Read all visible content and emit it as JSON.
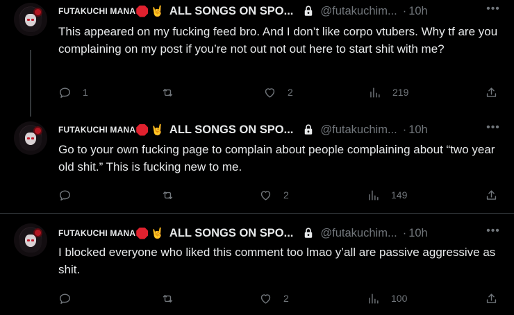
{
  "posts": [
    {
      "author_short": "FUTAKUCHI MANA",
      "author_suffix": "ALL SONGS ON SPO...",
      "handle": "@futakuchim...",
      "separator": "·",
      "time": "10h",
      "text": "This appeared on my fucking feed bro. And I don’t like corpo vtubers. Why tf are you complaining on my post if you’re not out not out here to start shit with me?",
      "replies": "1",
      "reposts": "",
      "likes": "2",
      "views": "219"
    },
    {
      "author_short": "FUTAKUCHI MANA",
      "author_suffix": "ALL SONGS ON SPO...",
      "handle": "@futakuchim...",
      "separator": "·",
      "time": "10h",
      "text": "Go to your own fucking page to complain about people complaining about “two year old shit.” This is fucking new to me.",
      "replies": "",
      "reposts": "",
      "likes": "2",
      "views": "149"
    },
    {
      "author_short": "FUTAKUCHI MANA",
      "author_suffix": "ALL SONGS ON SPO...",
      "handle": "@futakuchim...",
      "separator": "·",
      "time": "10h",
      "text": "I blocked everyone who liked this comment too lmao y’all are passive aggressive as shit.",
      "replies": "",
      "reposts": "",
      "likes": "2",
      "views": "100"
    }
  ],
  "icons": {
    "more": "more-options-icon",
    "reply": "reply-icon",
    "repost": "repost-icon",
    "like": "heart-icon",
    "views": "views-icon",
    "share": "share-icon",
    "lock": "lock-icon",
    "stop": "stop-sign-emoji",
    "horns": "sign-of-horns-emoji"
  },
  "colors": {
    "background": "#000000",
    "text": "#e7e9ea",
    "muted": "#71767b",
    "divider": "#2f3336"
  }
}
